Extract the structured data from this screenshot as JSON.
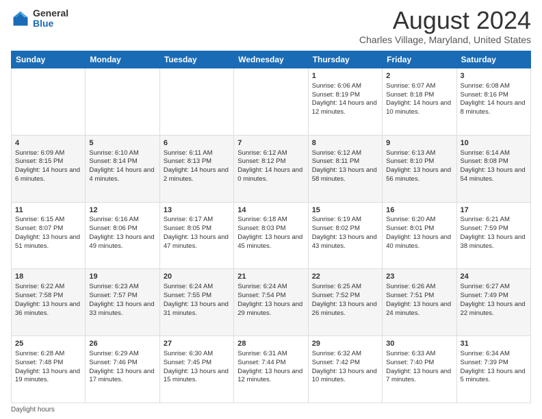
{
  "logo": {
    "general": "General",
    "blue": "Blue"
  },
  "title": "August 2024",
  "location": "Charles Village, Maryland, United States",
  "days_of_week": [
    "Sunday",
    "Monday",
    "Tuesday",
    "Wednesday",
    "Thursday",
    "Friday",
    "Saturday"
  ],
  "footer": "Daylight hours",
  "weeks": [
    [
      {
        "day": "",
        "content": ""
      },
      {
        "day": "",
        "content": ""
      },
      {
        "day": "",
        "content": ""
      },
      {
        "day": "",
        "content": ""
      },
      {
        "day": "1",
        "content": "Sunrise: 6:06 AM\nSunset: 8:19 PM\nDaylight: 14 hours and 12 minutes."
      },
      {
        "day": "2",
        "content": "Sunrise: 6:07 AM\nSunset: 8:18 PM\nDaylight: 14 hours and 10 minutes."
      },
      {
        "day": "3",
        "content": "Sunrise: 6:08 AM\nSunset: 8:16 PM\nDaylight: 14 hours and 8 minutes."
      }
    ],
    [
      {
        "day": "4",
        "content": "Sunrise: 6:09 AM\nSunset: 8:15 PM\nDaylight: 14 hours and 6 minutes."
      },
      {
        "day": "5",
        "content": "Sunrise: 6:10 AM\nSunset: 8:14 PM\nDaylight: 14 hours and 4 minutes."
      },
      {
        "day": "6",
        "content": "Sunrise: 6:11 AM\nSunset: 8:13 PM\nDaylight: 14 hours and 2 minutes."
      },
      {
        "day": "7",
        "content": "Sunrise: 6:12 AM\nSunset: 8:12 PM\nDaylight: 14 hours and 0 minutes."
      },
      {
        "day": "8",
        "content": "Sunrise: 6:12 AM\nSunset: 8:11 PM\nDaylight: 13 hours and 58 minutes."
      },
      {
        "day": "9",
        "content": "Sunrise: 6:13 AM\nSunset: 8:10 PM\nDaylight: 13 hours and 56 minutes."
      },
      {
        "day": "10",
        "content": "Sunrise: 6:14 AM\nSunset: 8:08 PM\nDaylight: 13 hours and 54 minutes."
      }
    ],
    [
      {
        "day": "11",
        "content": "Sunrise: 6:15 AM\nSunset: 8:07 PM\nDaylight: 13 hours and 51 minutes."
      },
      {
        "day": "12",
        "content": "Sunrise: 6:16 AM\nSunset: 8:06 PM\nDaylight: 13 hours and 49 minutes."
      },
      {
        "day": "13",
        "content": "Sunrise: 6:17 AM\nSunset: 8:05 PM\nDaylight: 13 hours and 47 minutes."
      },
      {
        "day": "14",
        "content": "Sunrise: 6:18 AM\nSunset: 8:03 PM\nDaylight: 13 hours and 45 minutes."
      },
      {
        "day": "15",
        "content": "Sunrise: 6:19 AM\nSunset: 8:02 PM\nDaylight: 13 hours and 43 minutes."
      },
      {
        "day": "16",
        "content": "Sunrise: 6:20 AM\nSunset: 8:01 PM\nDaylight: 13 hours and 40 minutes."
      },
      {
        "day": "17",
        "content": "Sunrise: 6:21 AM\nSunset: 7:59 PM\nDaylight: 13 hours and 38 minutes."
      }
    ],
    [
      {
        "day": "18",
        "content": "Sunrise: 6:22 AM\nSunset: 7:58 PM\nDaylight: 13 hours and 36 minutes."
      },
      {
        "day": "19",
        "content": "Sunrise: 6:23 AM\nSunset: 7:57 PM\nDaylight: 13 hours and 33 minutes."
      },
      {
        "day": "20",
        "content": "Sunrise: 6:24 AM\nSunset: 7:55 PM\nDaylight: 13 hours and 31 minutes."
      },
      {
        "day": "21",
        "content": "Sunrise: 6:24 AM\nSunset: 7:54 PM\nDaylight: 13 hours and 29 minutes."
      },
      {
        "day": "22",
        "content": "Sunrise: 6:25 AM\nSunset: 7:52 PM\nDaylight: 13 hours and 26 minutes."
      },
      {
        "day": "23",
        "content": "Sunrise: 6:26 AM\nSunset: 7:51 PM\nDaylight: 13 hours and 24 minutes."
      },
      {
        "day": "24",
        "content": "Sunrise: 6:27 AM\nSunset: 7:49 PM\nDaylight: 13 hours and 22 minutes."
      }
    ],
    [
      {
        "day": "25",
        "content": "Sunrise: 6:28 AM\nSunset: 7:48 PM\nDaylight: 13 hours and 19 minutes."
      },
      {
        "day": "26",
        "content": "Sunrise: 6:29 AM\nSunset: 7:46 PM\nDaylight: 13 hours and 17 minutes."
      },
      {
        "day": "27",
        "content": "Sunrise: 6:30 AM\nSunset: 7:45 PM\nDaylight: 13 hours and 15 minutes."
      },
      {
        "day": "28",
        "content": "Sunrise: 6:31 AM\nSunset: 7:44 PM\nDaylight: 13 hours and 12 minutes."
      },
      {
        "day": "29",
        "content": "Sunrise: 6:32 AM\nSunset: 7:42 PM\nDaylight: 13 hours and 10 minutes."
      },
      {
        "day": "30",
        "content": "Sunrise: 6:33 AM\nSunset: 7:40 PM\nDaylight: 13 hours and 7 minutes."
      },
      {
        "day": "31",
        "content": "Sunrise: 6:34 AM\nSunset: 7:39 PM\nDaylight: 13 hours and 5 minutes."
      }
    ]
  ]
}
